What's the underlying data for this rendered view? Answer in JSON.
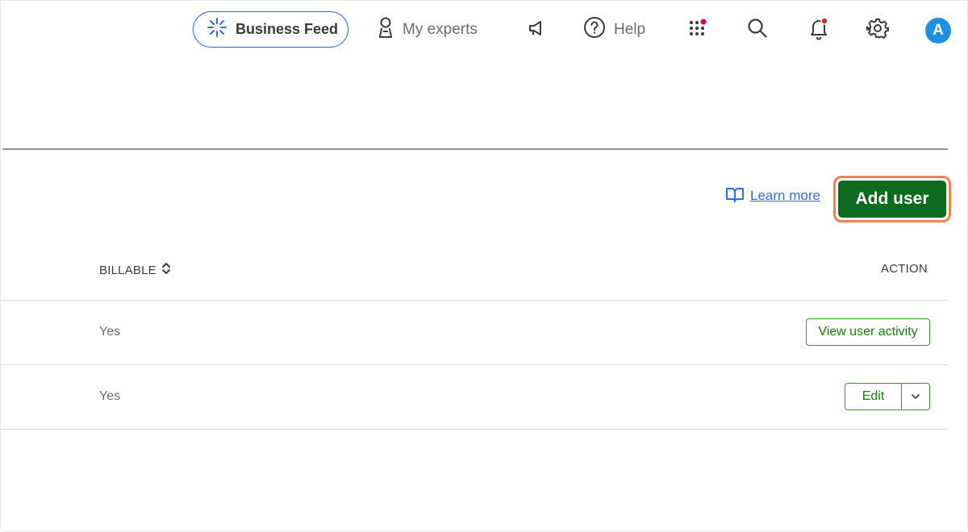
{
  "topbar": {
    "business_feed": "Business Feed",
    "my_experts": "My experts",
    "help": "Help",
    "avatar_initial": "A",
    "icons": [
      "sparkle-icon",
      "person-icon",
      "megaphone-icon",
      "help-circle-icon",
      "apps-grid-icon",
      "search-icon",
      "bell-icon",
      "gear-icon"
    ]
  },
  "actions": {
    "learn_more": "Learn more",
    "add_user": "Add user"
  },
  "table": {
    "headers": [
      "BILLABLE",
      "ACTION"
    ],
    "rows": [
      {
        "billable": "Yes",
        "action": "View user activity"
      },
      {
        "billable": "Yes",
        "action": "Edit"
      }
    ]
  },
  "colors": {
    "accent_blue": "#2d6cdf",
    "primary_green": "#0d6b1f",
    "outline_green": "#2ca01c",
    "highlight_orange": "#f4824e",
    "notification_dot": "#d52b1e",
    "apps_dot": "#d10068"
  }
}
